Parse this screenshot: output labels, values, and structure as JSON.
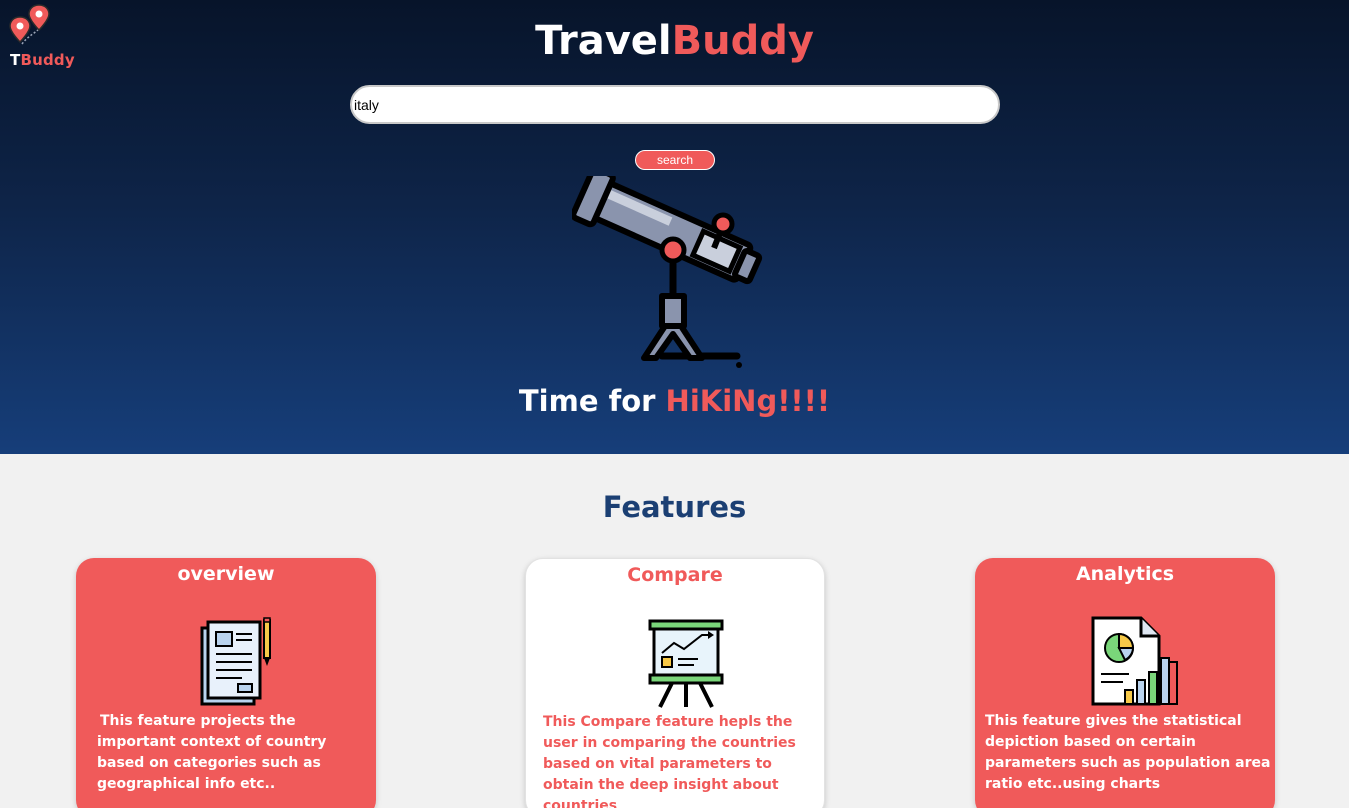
{
  "logo": {
    "text_part1": "T",
    "text_part2": "Buddy",
    "icon": "map-pins-icon"
  },
  "header": {
    "brand_part1": "Travel",
    "brand_part2": "Buddy"
  },
  "search": {
    "value": "italy",
    "placeholder": "",
    "button_label": "search"
  },
  "hero": {
    "image": "telescope-icon",
    "tagline_part1": "Time for ",
    "tagline_part2": "HiKiNg!!!!"
  },
  "features": {
    "title": "Features",
    "cards": [
      {
        "title": "overview",
        "icon": "document-icon",
        "description": "This feature projects the important context of country based on categories such as geographical info etc.."
      },
      {
        "title": "Compare",
        "icon": "presentation-board-icon",
        "description": "This Compare feature hepls the user in comparing the countries based on vital parameters to obtain the deep insight about countries"
      },
      {
        "title": "Analytics",
        "icon": "analytics-report-icon",
        "description": "This feature gives the statistical depiction based on certain parameters such as population area ratio etc..using charts"
      }
    ]
  },
  "colors": {
    "accent": "#f05a5a",
    "hero_top": "#07142a",
    "hero_bottom": "#163e7a",
    "features_title": "#1b3f73",
    "page_bg": "#f1f1f1"
  }
}
